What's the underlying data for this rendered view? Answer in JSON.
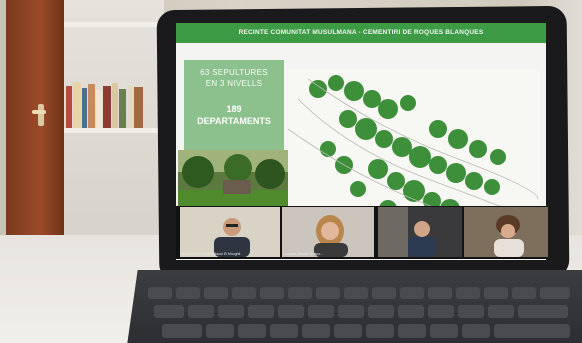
{
  "slide": {
    "title": "RECINTE COMUNITAT MUSULMANA - CEMENTIRI DE ROQUES BLANQUES",
    "info_line1": "63 SEPULTURES",
    "info_line2": "EN 3 NIVELLS",
    "info_line3": "189",
    "info_line4": "DEPARTAMENTS"
  },
  "participants": [
    {
      "name": "Mohammed El Mouddaoui El Moughit"
    },
    {
      "name": "Lourdes Bernat Crespo..."
    },
    {
      "name": ""
    },
    {
      "name": ""
    }
  ],
  "colors": {
    "slide_green": "#3d9b45",
    "info_box_green": "#8cc08d",
    "tablet_bezel": "#1a1a1c"
  }
}
